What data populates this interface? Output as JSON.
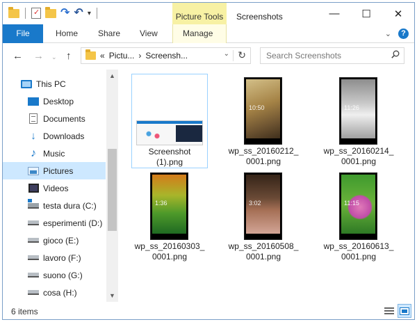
{
  "window": {
    "title": "Screenshots",
    "contextual_tab": "Picture Tools",
    "controls": {
      "minimize": "—",
      "maximize": "☐",
      "close": "✕"
    }
  },
  "ribbon": {
    "tabs": [
      {
        "label": "File"
      },
      {
        "label": "Home"
      },
      {
        "label": "Share"
      },
      {
        "label": "View"
      },
      {
        "label": "Manage"
      }
    ],
    "help": "?"
  },
  "address": {
    "overflow": "«",
    "crumbs": [
      "Pictu...",
      "Screensh..."
    ],
    "separator": "›"
  },
  "search": {
    "placeholder": "Search Screenshots"
  },
  "nav": {
    "items": [
      {
        "label": "This PC",
        "icon": "computer-icon"
      },
      {
        "label": "Desktop",
        "icon": "desktop-icon"
      },
      {
        "label": "Documents",
        "icon": "documents-icon"
      },
      {
        "label": "Downloads",
        "icon": "downloads-icon"
      },
      {
        "label": "Music",
        "icon": "music-icon"
      },
      {
        "label": "Pictures",
        "icon": "pictures-icon",
        "selected": true
      },
      {
        "label": "Videos",
        "icon": "videos-icon"
      },
      {
        "label": "testa dura (C:)",
        "icon": "system-drive-icon"
      },
      {
        "label": "esperimenti (D:)",
        "icon": "drive-icon"
      },
      {
        "label": "gioco (E:)",
        "icon": "drive-icon"
      },
      {
        "label": "lavoro (F:)",
        "icon": "drive-icon"
      },
      {
        "label": "suono (G:)",
        "icon": "drive-icon"
      },
      {
        "label": "cosa (H:)",
        "icon": "drive-icon"
      }
    ]
  },
  "files": [
    {
      "line1": "Screenshot",
      "line2": "(1).png",
      "selected": true
    },
    {
      "line1": "wp_ss_20160212_",
      "line2": "0001.png",
      "clock": "10:50"
    },
    {
      "line1": "wp_ss_20160214_",
      "line2": "0001.png",
      "clock": "11:26"
    },
    {
      "line1": "wp_ss_20160303_",
      "line2": "0001.png",
      "clock": "1:36"
    },
    {
      "line1": "wp_ss_20160508_",
      "line2": "0001.png",
      "clock": "3:02"
    },
    {
      "line1": "wp_ss_20160613_",
      "line2": "0001.png",
      "clock": "11:15"
    }
  ],
  "status": {
    "count": "6 items"
  },
  "colors": {
    "accent": "#1979ca",
    "selection": "#cde8ff",
    "contextual": "#f7f1a4"
  }
}
